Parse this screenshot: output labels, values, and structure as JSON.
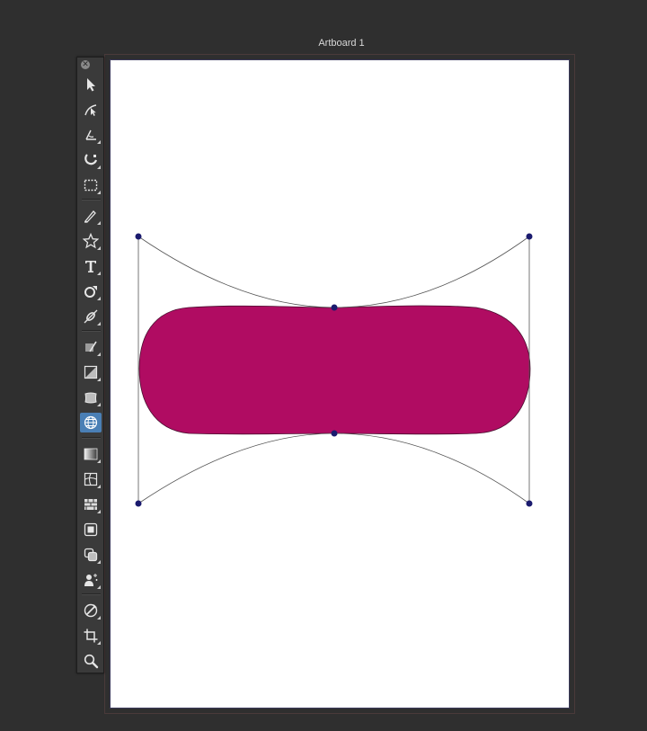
{
  "artboard": {
    "title": "Artboard 1"
  },
  "toolbar": {
    "close_glyph": "✕",
    "tools": [
      {
        "name": "selection-tool",
        "icon": "arrow-icon",
        "active": false
      },
      {
        "name": "direct-selection-tool",
        "icon": "direct-select-icon",
        "active": false
      },
      {
        "name": "curvature-tool",
        "icon": "curvature-icon",
        "active": false
      },
      {
        "name": "lasso-tool",
        "icon": "lasso-icon",
        "active": false
      },
      {
        "name": "rectangular-marquee-tool",
        "icon": "marquee-icon",
        "active": false
      },
      {
        "name": "pen-tool",
        "icon": "pen-icon",
        "active": false
      },
      {
        "name": "star-tool",
        "icon": "star-icon",
        "active": false
      },
      {
        "name": "type-tool",
        "icon": "type-icon",
        "active": false
      },
      {
        "name": "rotate-tool",
        "icon": "rotate-icon",
        "active": false
      },
      {
        "name": "scale-tool",
        "icon": "scale-icon",
        "active": false
      },
      {
        "name": "shape-builder-tool",
        "icon": "shape-builder-icon",
        "active": false
      },
      {
        "name": "width-tool",
        "icon": "width-icon",
        "active": false
      },
      {
        "name": "free-transform-tool",
        "icon": "free-transform-icon",
        "active": false
      },
      {
        "name": "envelope-distort-tool",
        "icon": "globe-grid-icon",
        "active": true
      },
      {
        "name": "gradient-tool",
        "icon": "gradient-icon",
        "active": false
      },
      {
        "name": "mesh-tool",
        "icon": "mesh-icon",
        "active": false
      },
      {
        "name": "pattern-tool",
        "icon": "brick-icon",
        "active": false
      },
      {
        "name": "live-paint-tool",
        "icon": "live-paint-icon",
        "active": false
      },
      {
        "name": "shape-overlap-tool",
        "icon": "overlap-icon",
        "active": false
      },
      {
        "name": "symbol-sprayer-tool",
        "icon": "symbol-sprayer-icon",
        "active": false
      },
      {
        "name": "eyedropper-tool",
        "icon": "eyedropper-icon",
        "active": false
      },
      {
        "name": "crop-tool",
        "icon": "crop-icon",
        "active": false
      },
      {
        "name": "zoom-tool",
        "icon": "magnifier-icon",
        "active": false
      }
    ]
  },
  "colors": {
    "fill": "#b00c62",
    "anchor": "#1a1a6e",
    "envelope_line": "#555555",
    "accent_active": "#4a7fb5"
  }
}
